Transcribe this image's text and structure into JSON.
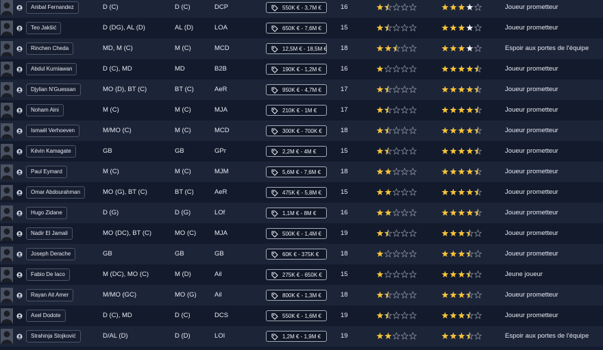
{
  "colors": {
    "star_gold": "#f5c33b",
    "star_white": "#f4f5f8",
    "star_empty": "#8a909d"
  },
  "icons": {
    "person": "person-icon",
    "value": "price-tag-icon",
    "star": "star-icon"
  },
  "players": [
    {
      "name": "Anibal Fernandez",
      "positions": "D (C)",
      "best_position": "D (C)",
      "role": "DCP",
      "value": "550K € - 3,7M €",
      "age": "16",
      "ability_stars": 1.5,
      "potential_stars": 4,
      "potential_color": "white",
      "status": "Joueur prometteur"
    },
    {
      "name": "Teo Jakšić",
      "positions": "D (DG), AL (D)",
      "best_position": "AL (D)",
      "role": "LOA",
      "value": "650K € - 7,6M €",
      "age": "15",
      "ability_stars": 1.5,
      "potential_stars": 4,
      "potential_color": "white",
      "status": "Joueur prometteur"
    },
    {
      "name": "Rinchen Cheda",
      "positions": "MD, M (C)",
      "best_position": "M (C)",
      "role": "MCD",
      "value": "12,5M € - 18,5M €",
      "age": "18",
      "ability_stars": 2.5,
      "potential_stars": 4,
      "potential_color": "white",
      "status": "Espoir aux portes de l'équipe"
    },
    {
      "name": "Abdul Kurniawan",
      "positions": "D (C), MD",
      "best_position": "MD",
      "role": "B2B",
      "value": "190K € - 1,2M €",
      "age": "16",
      "ability_stars": 1,
      "potential_stars": 4.5,
      "potential_color": "white",
      "status": "Joueur prometteur"
    },
    {
      "name": "Djylian N'Guessan",
      "positions": "MO (D), BT (C)",
      "best_position": "BT (C)",
      "role": "AeR",
      "value": "950K € - 4,7M €",
      "age": "17",
      "ability_stars": 1.5,
      "potential_stars": 4.5,
      "potential_color": "white",
      "status": "Joueur prometteur"
    },
    {
      "name": "Noham Aini",
      "positions": "M (C)",
      "best_position": "M (C)",
      "role": "MJA",
      "value": "210K € - 1M €",
      "age": "17",
      "ability_stars": 1.5,
      "potential_stars": 4.5,
      "potential_color": "white",
      "status": "Joueur prometteur"
    },
    {
      "name": "Ismaël Verhoeven",
      "positions": "M/MO (C)",
      "best_position": "M (C)",
      "role": "MCD",
      "value": "300K € - 700K €",
      "age": "18",
      "ability_stars": 1.5,
      "potential_stars": 4.5,
      "potential_color": "white",
      "status": "Joueur prometteur"
    },
    {
      "name": "Kévin Kamagate",
      "positions": "GB",
      "best_position": "GB",
      "role": "GPr",
      "value": "2,2M € - 4M €",
      "age": "15",
      "ability_stars": 1.5,
      "potential_stars": 4.5,
      "potential_color": "white",
      "status": "Joueur prometteur"
    },
    {
      "name": "Paul Eymard",
      "positions": "M (C)",
      "best_position": "M (C)",
      "role": "MJM",
      "value": "5,6M € - 7,6M €",
      "age": "18",
      "ability_stars": 2,
      "potential_stars": 4.5,
      "potential_color": "white",
      "status": "Joueur prometteur"
    },
    {
      "name": "Omar Abdourahman",
      "positions": "MO (G), BT (C)",
      "best_position": "BT (C)",
      "role": "AeR",
      "value": "475K € - 5,8M €",
      "age": "15",
      "ability_stars": 2,
      "potential_stars": 4.5,
      "potential_color": "white",
      "status": "Joueur prometteur"
    },
    {
      "name": "Hugo Zidane",
      "positions": "D (G)",
      "best_position": "D (G)",
      "role": "LOf",
      "value": "1,1M € - 8M €",
      "age": "16",
      "ability_stars": 2,
      "potential_stars": 4.5,
      "potential_color": "white",
      "status": "Joueur prometteur"
    },
    {
      "name": "Nadir El Jamali",
      "positions": "MO (DC), BT (C)",
      "best_position": "MO (C)",
      "role": "MJA",
      "value": "500K € - 1,4M €",
      "age": "19",
      "ability_stars": 1.5,
      "potential_stars": 3.5,
      "potential_color": "gold",
      "status": "Joueur prometteur"
    },
    {
      "name": "Joseph Derache",
      "positions": "GB",
      "best_position": "GB",
      "role": "GB",
      "value": "60K € - 375K €",
      "age": "18",
      "ability_stars": 1,
      "potential_stars": 3.5,
      "potential_color": "gold",
      "status": "Joueur prometteur"
    },
    {
      "name": "Fabio De Iaco",
      "positions": "M (DC), MO (C)",
      "best_position": "M (D)",
      "role": "Ail",
      "value": "275K € - 650K €",
      "age": "15",
      "ability_stars": 1,
      "potential_stars": 3.5,
      "potential_color": "gold",
      "status": "Jeune joueur"
    },
    {
      "name": "Rayan Ait Amer",
      "positions": "M/MO (GC)",
      "best_position": "MO (G)",
      "role": "Ail",
      "value": "800K € - 1,3M €",
      "age": "18",
      "ability_stars": 1.5,
      "potential_stars": 3.5,
      "potential_color": "gold",
      "status": "Joueur prometteur"
    },
    {
      "name": "Axel Dodote",
      "positions": "D (C), MD",
      "best_position": "D (C)",
      "role": "DCS",
      "value": "550K € - 1,6M €",
      "age": "19",
      "ability_stars": 1.5,
      "potential_stars": 3.5,
      "potential_color": "gold",
      "status": "Joueur prometteur"
    },
    {
      "name": "Strahinja Stojković",
      "positions": "D/AL (D)",
      "best_position": "D (D)",
      "role": "LOI",
      "value": "1,2M € - 1,9M €",
      "age": "19",
      "ability_stars": 2,
      "potential_stars": 3.5,
      "potential_color": "gold",
      "status": "Espoir aux portes de l'équipe"
    }
  ]
}
